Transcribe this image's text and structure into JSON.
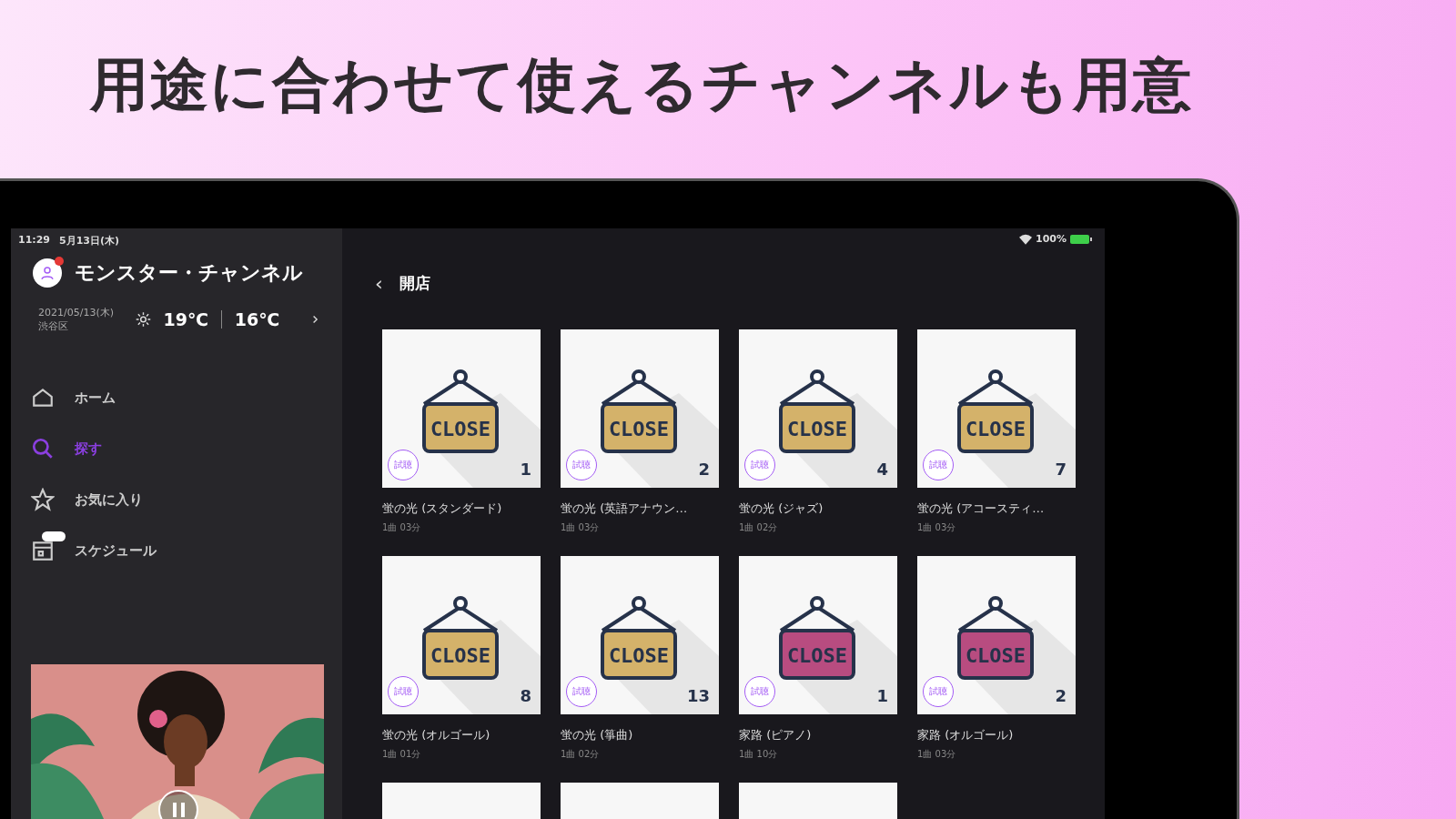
{
  "headline": "用途に合わせて使えるチャンネルも用意",
  "status_bar": {
    "time": "11:29",
    "date": "5月13日(木)",
    "battery": "100%"
  },
  "sidebar": {
    "channel_name": "モンスター・チャンネル",
    "notification": true,
    "date": "2021/05/13(木)",
    "location": "渋谷区",
    "weather": {
      "high": "19℃",
      "low": "16℃"
    },
    "items": [
      {
        "label": "ホーム",
        "kind": "home",
        "selected": false,
        "badge": false
      },
      {
        "label": "探す",
        "kind": "search",
        "selected": true,
        "badge": false
      },
      {
        "label": "お気に入り",
        "kind": "star",
        "selected": false,
        "badge": false
      },
      {
        "label": "スケジュール",
        "kind": "calendar",
        "selected": false,
        "badge": true
      }
    ],
    "player": {
      "kind": "picture",
      "playing": true
    }
  },
  "content": {
    "back": "‹",
    "title": "開店",
    "cards": [
      {
        "kind": "full",
        "sign_text": "CLOSE",
        "color": "#d4b26a",
        "trial": "試聴",
        "count": "1",
        "title": "蛍の光 (スタンダード)",
        "meta": "1曲 03分"
      },
      {
        "kind": "full",
        "sign_text": "CLOSE",
        "color": "#d4b26a",
        "trial": "試聴",
        "count": "2",
        "title": "蛍の光 (英語アナウン…",
        "meta": "1曲 03分"
      },
      {
        "kind": "full",
        "sign_text": "CLOSE",
        "color": "#d4b26a",
        "trial": "試聴",
        "count": "4",
        "title": "蛍の光 (ジャズ)",
        "meta": "1曲 02分"
      },
      {
        "kind": "full",
        "sign_text": "CLOSE",
        "color": "#d4b26a",
        "trial": "試聴",
        "count": "7",
        "title": "蛍の光 (アコースティ…",
        "meta": "1曲 03分"
      },
      {
        "kind": "full",
        "sign_text": "CLOSE",
        "color": "#d4b26a",
        "trial": "試聴",
        "count": "8",
        "title": "蛍の光 (オルゴール)",
        "meta": "1曲 01分"
      },
      {
        "kind": "full",
        "sign_text": "CLOSE",
        "color": "#d4b26a",
        "trial": "試聴",
        "count": "13",
        "title": "蛍の光 (箏曲)",
        "meta": "1曲 02分"
      },
      {
        "kind": "full",
        "sign_text": "CLOSE",
        "color": "#b84c80",
        "trial": "試聴",
        "count": "1",
        "title": "家路 (ピアノ)",
        "meta": "1曲 10分"
      },
      {
        "kind": "full",
        "sign_text": "CLOSE",
        "color": "#b84c80",
        "trial": "試聴",
        "count": "2",
        "title": "家路 (オルゴール)",
        "meta": "1曲 03分"
      },
      {
        "kind": "cut"
      },
      {
        "kind": "cut"
      },
      {
        "kind": "cut"
      }
    ]
  }
}
